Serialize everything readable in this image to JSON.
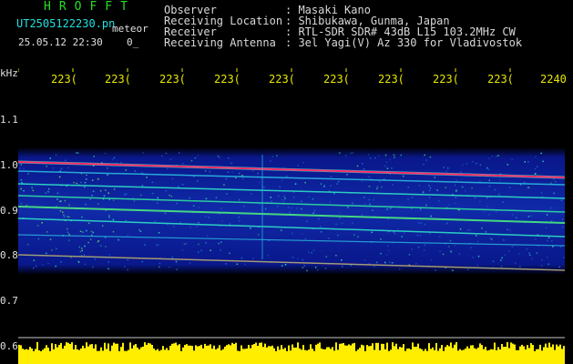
{
  "header": {
    "brand": "HROFFT",
    "filename": "UT2505122230.pn",
    "meteor_label": "meteor",
    "datetime": "25.05.12 22:30",
    "count": "0_",
    "fields": [
      {
        "label": "Observer",
        "value": ": Masaki Kano"
      },
      {
        "label": "Receiving Location",
        "value": ": Shibukawa, Gunma, Japan"
      },
      {
        "label": "Receiver",
        "value": ": RTL-SDR SDR# 43dB L15 103.2MHz CW"
      },
      {
        "label": "Receiving Antenna",
        "value": ": 3el Yagi(V) Az 330 for Vladivostok"
      }
    ]
  },
  "axis": {
    "y_unit": "kHz",
    "y_ticks": [
      "1.1",
      "1.0",
      "0.9",
      "0.8",
      "0.7",
      "0.6"
    ],
    "x_ticks": [
      "223(",
      "223(",
      "223(",
      "223(",
      "223(",
      "223(",
      "223(",
      "223(",
      "223(",
      "2240"
    ]
  },
  "colors": {
    "background": "#000000",
    "noise_low": "#0a1a9a",
    "noise_mid": "#1f7ae0",
    "trace": "#2de0c8",
    "hot_trace": "#ff2a6a",
    "level_bar": "#ffee00",
    "tick_text": "#e8e800",
    "brand": "#22e022"
  }
}
